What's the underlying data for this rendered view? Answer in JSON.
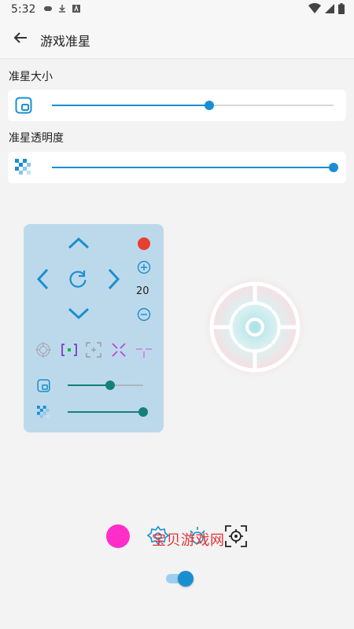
{
  "status": {
    "time": "5:32",
    "icons": [
      "gamepad-icon",
      "download-icon",
      "font-icon",
      "wifi-icon",
      "signal-icon",
      "battery-icon"
    ]
  },
  "appbar": {
    "title": "游戏准星",
    "back_icon": "back-arrow-icon"
  },
  "settings": {
    "size_label": "准星大小",
    "size_value": 0.56,
    "opacity_label": "准星透明度",
    "opacity_value": 1.0
  },
  "panel": {
    "counter": "20",
    "size_value": 0.56,
    "opacity_value": 0.96
  },
  "bottom": {
    "watermark": "宝贝游戏网",
    "accent": "#1a8fd0",
    "pink": "#ff2ec9",
    "toggle_on": true
  }
}
